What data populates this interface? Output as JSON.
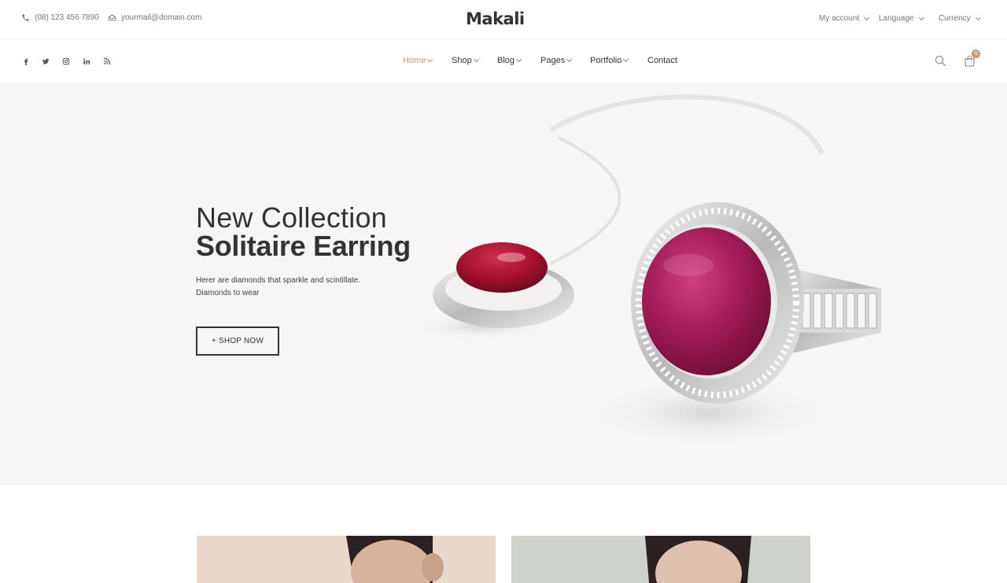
{
  "topbar": {
    "phone": "(08) 123 456 7890",
    "email": "yourmail@domain.com",
    "logo": "Makali",
    "account_label": "My account",
    "language_label": "Language",
    "currency_label": "Currency"
  },
  "social": [
    "facebook-icon",
    "twitter-icon",
    "instagram-icon",
    "linkedin-icon",
    "rss-icon"
  ],
  "nav": {
    "home": "Home",
    "shop": "Shop",
    "blog": "Blog",
    "pages": "Pages",
    "portfolio": "Portfolio",
    "contact": "Contact"
  },
  "cart": {
    "count": "0"
  },
  "hero": {
    "subtitle": "New Collection",
    "title": "Solitaire Earring",
    "text_line1": "Herer are diamonds that sparkle and scintillate.",
    "text_line2": "Diamonds to wear",
    "button": "+ SHOP NOW"
  },
  "colors": {
    "accent": "#c79a7a",
    "hero_bg": "#f8f6f5",
    "text": "#333333"
  }
}
